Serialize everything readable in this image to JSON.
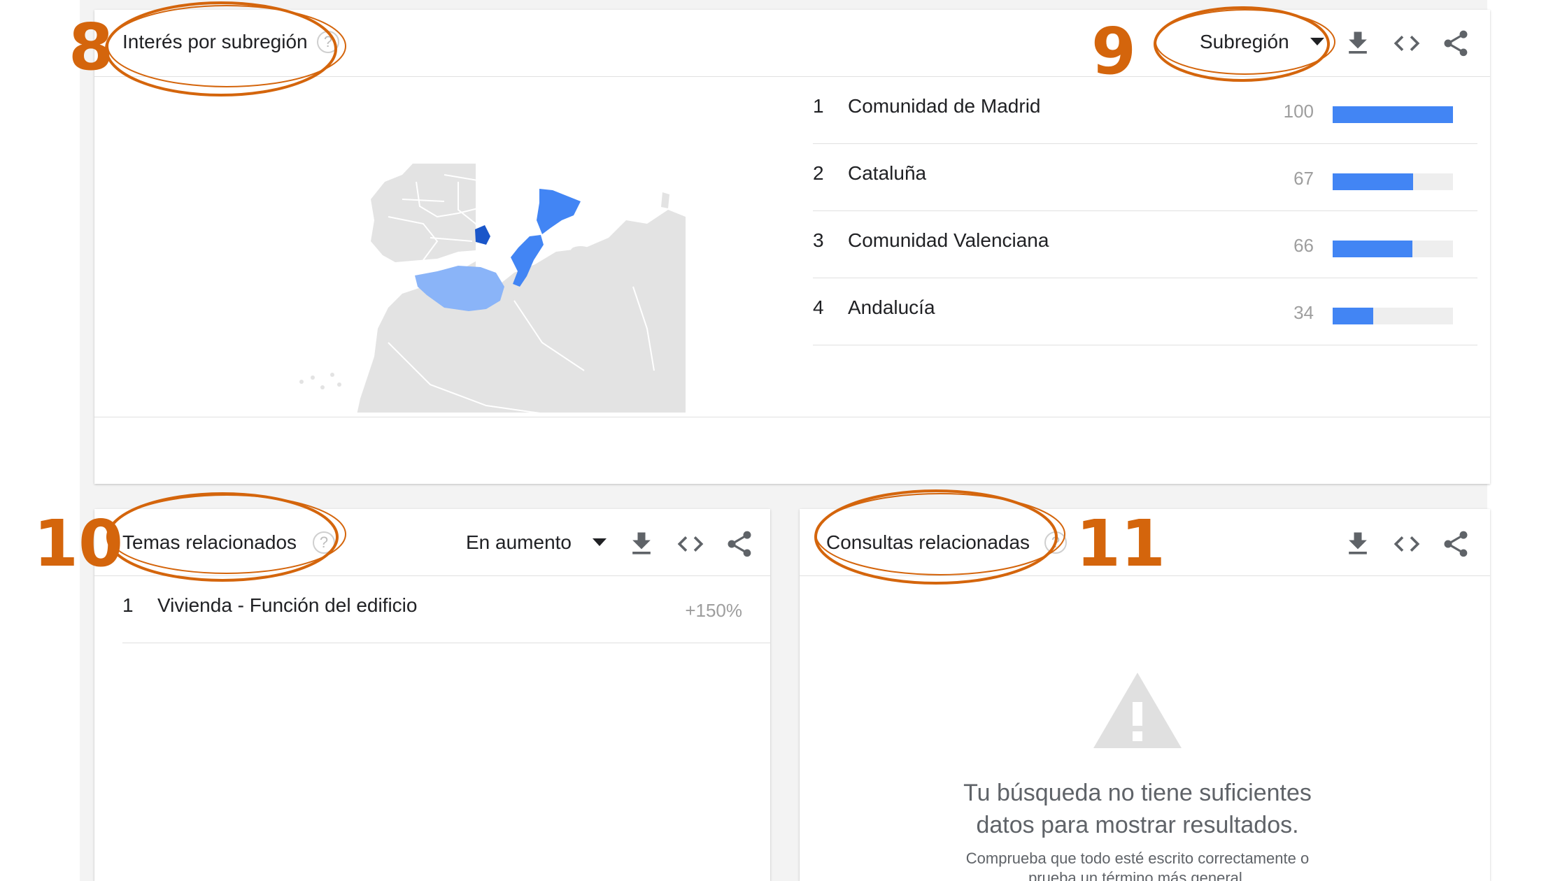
{
  "colors": {
    "accent": "#4285f4",
    "annotation": "#d4650c",
    "map_land": "#e0e0e0"
  },
  "annotations": {
    "n8": "8",
    "n9": "9",
    "n10": "10",
    "n11": "11"
  },
  "subregion_card": {
    "title": "Interés por subregión",
    "help_icon": "?",
    "dropdown_label": "Subregión",
    "icons": [
      "download-icon",
      "embed-icon",
      "share-icon"
    ],
    "rows": [
      {
        "rank": "1",
        "name": "Comunidad de Madrid",
        "value": "100",
        "level": 100
      },
      {
        "rank": "2",
        "name": "Cataluña",
        "value": "67",
        "level": 67
      },
      {
        "rank": "3",
        "name": "Comunidad Valenciana",
        "value": "66",
        "level": 66
      },
      {
        "rank": "4",
        "name": "Andalucía",
        "value": "34",
        "level": 34
      }
    ]
  },
  "topics_card": {
    "title": "Temas relacionados",
    "help_icon": "?",
    "dropdown_label": "En aumento",
    "rows": [
      {
        "rank": "1",
        "name": "Vivienda - Función del edificio",
        "value": "+150%"
      }
    ]
  },
  "queries_card": {
    "title": "Consultas relacionadas",
    "help_icon": "?",
    "empty_title": "Tu búsqueda no tiene suficientes datos para mostrar resultados.",
    "empty_hint": "Comprueba que todo esté escrito correctamente o prueba un término más general."
  }
}
